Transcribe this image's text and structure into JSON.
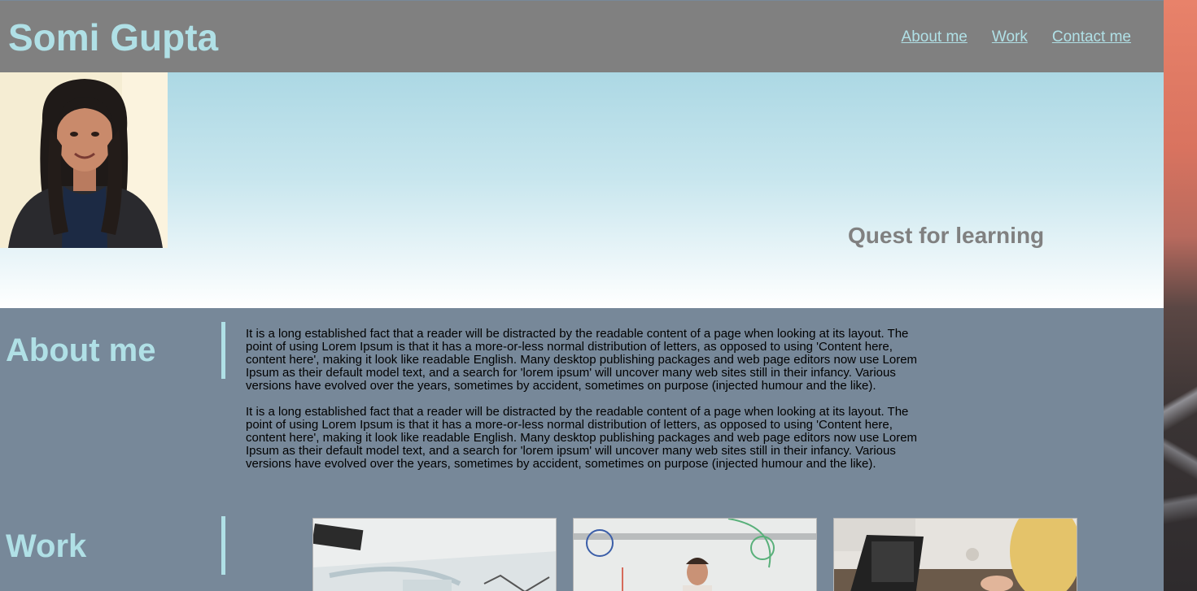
{
  "header": {
    "site_title": "Somi Gupta",
    "nav": [
      {
        "label": "About me"
      },
      {
        "label": "Work"
      },
      {
        "label": "Contact me"
      }
    ]
  },
  "hero": {
    "tagline": "Quest for learning"
  },
  "about": {
    "heading": "About me",
    "paragraphs": [
      "It is a long established fact that a reader will be distracted by the readable content of a page when looking at its layout. The point of using Lorem Ipsum is that it has a more-or-less normal distribution of letters, as opposed to using 'Content here, content here', making it look like readable English. Many desktop publishing packages and web page editors now use Lorem Ipsum as their default model text, and a search for 'lorem ipsum' will uncover many web sites still in their infancy. Various versions have evolved over the years, sometimes by accident, sometimes on purpose (injected humour and the like).",
      "It is a long established fact that a reader will be distracted by the readable content of a page when looking at its layout. The point of using Lorem Ipsum is that it has a more-or-less normal distribution of letters, as opposed to using 'Content here, content here', making it look like readable English. Many desktop publishing packages and web page editors now use Lorem Ipsum as their default model text, and a search for 'lorem ipsum' will uncover many web sites still in their infancy. Various versions have evolved over the years, sometimes by accident, sometimes on purpose (injected humour and the like)."
    ]
  },
  "work": {
    "heading": "Work"
  },
  "colors": {
    "header_bg": "#808080",
    "accent": "#b0e0e6",
    "section_bg": "#778899",
    "tagline": "#808080"
  }
}
